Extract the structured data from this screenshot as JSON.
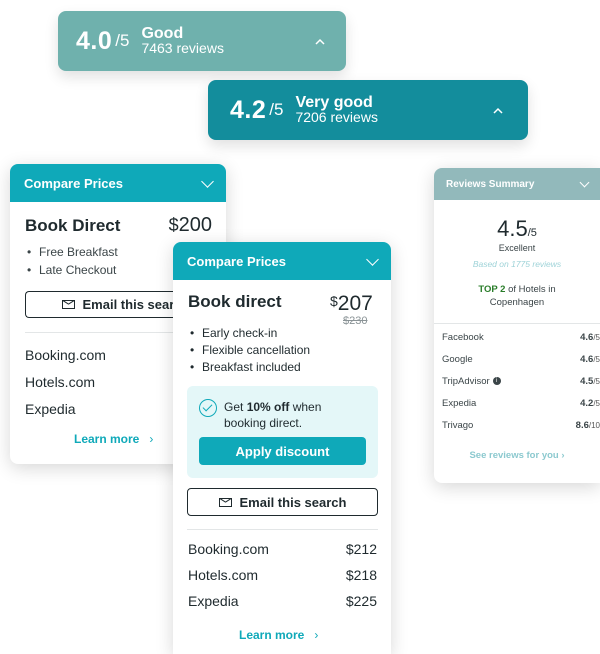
{
  "ratings": [
    {
      "score": "4.0",
      "out_of": "/5",
      "label": "Good",
      "count": "7463 reviews",
      "color": "#6fb1ad"
    },
    {
      "score": "4.2",
      "out_of": "/5",
      "label": "Very good",
      "count": "7206 reviews",
      "color": "#138d9c"
    }
  ],
  "colors": {
    "accent": "#0fa9b9",
    "promo_bg": "#e4f7f8",
    "review_header": "#92b9bb"
  },
  "compare_left": {
    "header": "Compare Prices",
    "title": "Book Direct",
    "currency": "$",
    "price": "200",
    "perks": [
      "Free Breakfast",
      "Late Checkout"
    ],
    "email_label": "Email this search",
    "providers": [
      "Booking.com",
      "Hotels.com",
      "Expedia"
    ],
    "learn_more": "Learn more",
    "learn_arrow": "›"
  },
  "compare_center": {
    "header": "Compare Prices",
    "title": "Book direct",
    "currency": "$",
    "price": "207",
    "old_price": "$230",
    "perks": [
      "Early check-in",
      "Flexible cancellation",
      "Breakfast included"
    ],
    "promo_prefix": "Get ",
    "promo_bold": "10% off",
    "promo_suffix": " when",
    "promo_line2": "booking direct.",
    "apply_label": "Apply discount",
    "email_label": "Email this search",
    "providers": [
      {
        "name": "Booking.com",
        "price": "$212"
      },
      {
        "name": "Hotels.com",
        "price": "$218"
      },
      {
        "name": "Expedia",
        "price": "$225"
      }
    ],
    "learn_more": "Learn more",
    "learn_arrow": "›"
  },
  "reviews_summary": {
    "header": "Reviews Summary",
    "score": "4.5",
    "out_of": "/5",
    "label": "Excellent",
    "based_on": "Based on 1775 reviews",
    "top_bold": "TOP 2",
    "top_rest": " of Hotels in",
    "top_line2": "Copenhagen",
    "sources": [
      {
        "name": "Facebook",
        "value": "4.6",
        "of": "/5"
      },
      {
        "name": "Google",
        "value": "4.6",
        "of": "/5"
      },
      {
        "name": "TripAdvisor",
        "value": "4.5",
        "of": "/5"
      },
      {
        "name": "Expedia",
        "value": "4.2",
        "of": "/5"
      },
      {
        "name": "Trivago",
        "value": "8.6",
        "of": "/10"
      }
    ],
    "see_reviews": "See reviews for you",
    "see_arrow": "›"
  }
}
